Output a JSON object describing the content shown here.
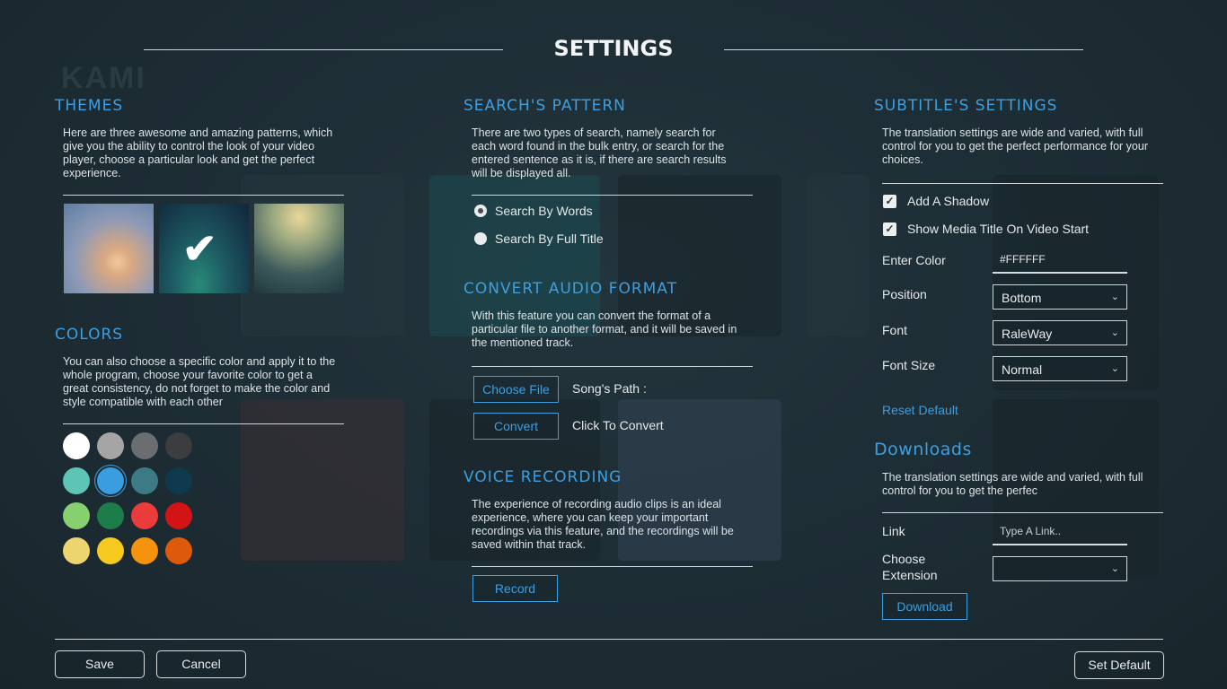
{
  "title": "SETTINGS",
  "backdrop": {
    "logo_text": "KAMI"
  },
  "themes": {
    "title": "THEMES",
    "description": "Here are three awesome and amazing patterns, which give you the ability to control the look of your video player, choose a particular look and get the perfect experience.",
    "selected_index": 1
  },
  "colors": {
    "title": "COLORS",
    "description": "You can also choose a specific color and apply it to the whole program, choose your favorite color to get a great consistency, do not forget to make the color and style compatible with each other",
    "palette": [
      "#ffffff",
      "#a5a5a5",
      "#6a6e70",
      "#3b3d3f",
      "#5ec4b6",
      "#3a9de0",
      "#3c7a86",
      "#0f3a4e",
      "#86d06f",
      "#1d7d4a",
      "#ec3b3b",
      "#d21414",
      "#ecd56e",
      "#f6c91e",
      "#f6930e",
      "#de5a0a"
    ],
    "selected_index": 5
  },
  "search": {
    "title": "SEARCH'S PATTERN",
    "description": "There are two types of search, namely search for each word found in the bulk entry, or search for the entered sentence as it is, if there are search results will be displayed all.",
    "options": [
      "Search By Words",
      "Search By Full Title"
    ],
    "selected_index": 0
  },
  "convert": {
    "title": "CONVERT AUDIO FORMAT",
    "description": "With this feature you can convert the format of a particular file to another format, and it will be saved in the mentioned track.",
    "choose_file_label": "Choose File",
    "songs_path_label": "Song's Path :",
    "convert_label": "Convert",
    "click_to_convert_label": "Click To Convert"
  },
  "voice": {
    "title": "VOICE RECORDING",
    "description": "The experience of recording audio clips is an ideal experience, where you can keep your important recordings via this feature, and the recordings will be saved within that track.",
    "record_label": "Record"
  },
  "subtitles": {
    "title": "SUBTITLE'S SETTINGS",
    "description": "The translation settings are wide and varied, with full control for you to get the perfect performance for your choices.",
    "shadow_label": "Add A Shadow",
    "shadow_checked": true,
    "show_title_label": "Show Media Title On Video Start",
    "show_title_checked": true,
    "enter_color_label": "Enter Color",
    "color_value": "#FFFFFF",
    "position_label": "Position",
    "position_value": "Bottom",
    "font_label": "Font",
    "font_value": "RaleWay",
    "font_size_label": "Font Size",
    "font_size_value": "Normal",
    "reset_label": "Reset Default",
    "check_glyph": "✓",
    "chevron_glyph": "⌄"
  },
  "downloads": {
    "title": "Downloads",
    "description": "The translation settings are wide and varied, with full control for you to get the perfec",
    "link_label": "Link",
    "link_placeholder": "Type A Link..",
    "extension_label": "Choose Extension",
    "extension_value": "",
    "download_label": "Download"
  },
  "footer": {
    "save_label": "Save",
    "cancel_label": "Cancel",
    "set_default_label": "Set Default"
  }
}
